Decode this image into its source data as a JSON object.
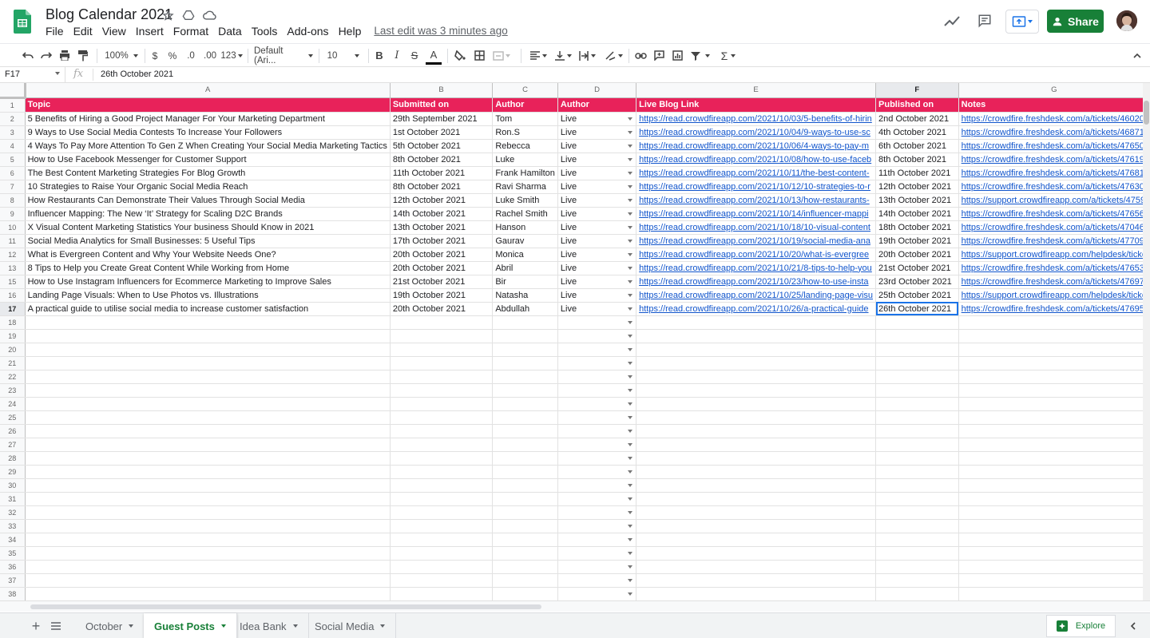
{
  "app": {
    "title": "Blog Calendar 2021",
    "menus": [
      "File",
      "Edit",
      "View",
      "Insert",
      "Format",
      "Data",
      "Tools",
      "Add-ons",
      "Help"
    ],
    "last_edit": "Last edit was 3 minutes ago",
    "share_label": "Share",
    "brand_color": "#188038",
    "header_row_color": "#e8225a"
  },
  "toolbar": {
    "zoom": "100%",
    "currency": "$",
    "percent": "%",
    "decimal_decrease": ".0",
    "decimal_increase": ".00",
    "more_formats": "123",
    "font": "Default (Ari...",
    "font_size": "10",
    "bold": "B",
    "italic": "I",
    "strikethrough": "S",
    "text_color": "A",
    "sum": "Σ"
  },
  "formula_bar": {
    "cell_ref": "F17",
    "fx": "fx",
    "value": "26th October 2021"
  },
  "columns": [
    "A",
    "B",
    "C",
    "D",
    "E",
    "F",
    "G"
  ],
  "sheet": {
    "headers": [
      "Topic",
      "Submitted on",
      "Author",
      "Author",
      "Live Blog Link",
      "Published on",
      "Notes"
    ],
    "rows": [
      {
        "num": "2",
        "cells": [
          "5 Benefits of Hiring a Good Project Manager For Your Marketing Department",
          "29th September 2021",
          "Tom",
          "Live",
          "https://read.crowdfireapp.com/2021/10/03/5-benefits-of-hirin",
          "2nd October 2021",
          "https://crowdfire.freshdesk.com/a/tickets/46020"
        ]
      },
      {
        "num": "3",
        "cells": [
          "9 Ways to Use Social Media Contests To Increase Your Followers",
          "1st October 2021",
          "Ron.S",
          "Live",
          "https://read.crowdfireapp.com/2021/10/04/9-ways-to-use-sc",
          "4th October 2021",
          "https://crowdfire.freshdesk.com/a/tickets/46871"
        ]
      },
      {
        "num": "4",
        "cells": [
          "4 Ways To Pay More Attention To Gen Z When Creating Your Social Media Marketing Tactics",
          "5th October 2021",
          "Rebecca",
          "Live",
          "https://read.crowdfireapp.com/2021/10/06/4-ways-to-pay-m",
          "6th October 2021",
          "https://crowdfire.freshdesk.com/a/tickets/47650"
        ]
      },
      {
        "num": "5",
        "cells": [
          "How to Use Facebook Messenger for Customer Support",
          "8th October 2021",
          "Luke",
          "Live",
          "https://read.crowdfireapp.com/2021/10/08/how-to-use-faceb",
          "8th October 2021",
          "https://crowdfire.freshdesk.com/a/tickets/47619"
        ]
      },
      {
        "num": "6",
        "cells": [
          "The Best Content Marketing Strategies For Blog Growth",
          "11th October 2021",
          "Frank Hamilton",
          "Live",
          "https://read.crowdfireapp.com/2021/10/11/the-best-content-",
          "11th October 2021",
          "https://crowdfire.freshdesk.com/a/tickets/47681"
        ]
      },
      {
        "num": "7",
        "cells": [
          "10 Strategies to Raise Your Organic Social Media Reach",
          "8th October 2021",
          "Ravi Sharma",
          "Live",
          "https://read.crowdfireapp.com/2021/10/12/10-strategies-to-r",
          "12th October 2021",
          "https://crowdfire.freshdesk.com/a/tickets/47630"
        ]
      },
      {
        "num": "8",
        "cells": [
          "How Restaurants Can Demonstrate Their Values Through Social Media",
          "12th October 2021",
          "Luke Smith",
          "Live",
          "https://read.crowdfireapp.com/2021/10/13/how-restaurants-",
          "13th October 2021",
          "https://support.crowdfireapp.com/a/tickets/4759"
        ]
      },
      {
        "num": "9",
        "cells": [
          "Influencer Mapping: The New ‘It’ Strategy for Scaling D2C Brands",
          "14th October 2021",
          "Rachel Smith",
          "Live",
          "https://read.crowdfireapp.com/2021/10/14/influencer-mappi",
          "14th October 2021",
          "https://crowdfire.freshdesk.com/a/tickets/47656"
        ]
      },
      {
        "num": "10",
        "cells": [
          "X Visual Content Marketing Statistics Your business Should Know in 2021",
          "13th October 2021",
          "Hanson",
          "Live",
          "https://read.crowdfireapp.com/2021/10/18/10-visual-content",
          "18th October 2021",
          "https://crowdfire.freshdesk.com/a/tickets/47046"
        ]
      },
      {
        "num": "11",
        "cells": [
          "Social Media Analytics for Small Businesses: 5 Useful Tips",
          "17th October 2021",
          "Gaurav",
          "Live",
          "https://read.crowdfireapp.com/2021/10/19/social-media-ana",
          "19th October 2021",
          "https://crowdfire.freshdesk.com/a/tickets/47709"
        ]
      },
      {
        "num": "12",
        "cells": [
          "What is Evergreen Content and Why Your Website Needs One?",
          "20th October 2021",
          "Monica",
          "Live",
          "https://read.crowdfireapp.com/2021/10/20/what-is-evergree",
          "20th October 2021",
          "https://support.crowdfireapp.com/helpdesk/ticke"
        ]
      },
      {
        "num": "13",
        "cells": [
          "8 Tips to Help you Create Great Content While Working from Home",
          "20th October 2021",
          "Abril",
          "Live",
          "https://read.crowdfireapp.com/2021/10/21/8-tips-to-help-you",
          "21st October 2021",
          "https://crowdfire.freshdesk.com/a/tickets/47653"
        ]
      },
      {
        "num": "15",
        "cells": [
          "How to Use Instagram Influencers for Ecommerce Marketing to Improve Sales",
          "21st October 2021",
          "Bir",
          "Live",
          "https://read.crowdfireapp.com/2021/10/23/how-to-use-insta",
          "23rd October 2021",
          "https://crowdfire.freshdesk.com/a/tickets/47697"
        ]
      },
      {
        "num": "16",
        "cells": [
          "Landing Page Visuals: When to Use Photos vs. Illustrations",
          "19th October 2021",
          "Natasha",
          "Live",
          "https://read.crowdfireapp.com/2021/10/25/landing-page-visu",
          "25th October 2021",
          "https://support.crowdfireapp.com/helpdesk/ticke"
        ]
      },
      {
        "num": "17",
        "cells": [
          "A practical guide to utilise social media to increase customer satisfaction",
          "20th October 2021",
          "Abdullah",
          "Live",
          "https://read.crowdfireapp.com/2021/10/26/a-practical-guide",
          "26th October 2021",
          "https://crowdfire.freshdesk.com/a/tickets/47695"
        ]
      }
    ],
    "empty_rows": [
      "18",
      "19",
      "20",
      "21",
      "22",
      "23",
      "24",
      "25",
      "26",
      "27",
      "28",
      "29",
      "30",
      "31",
      "32",
      "33",
      "34",
      "35",
      "36",
      "37",
      "38"
    ]
  },
  "tabs": [
    "October",
    "Guest Posts",
    "Idea Bank",
    "Social Media"
  ],
  "active_tab": "Guest Posts",
  "explore_label": "Explore"
}
